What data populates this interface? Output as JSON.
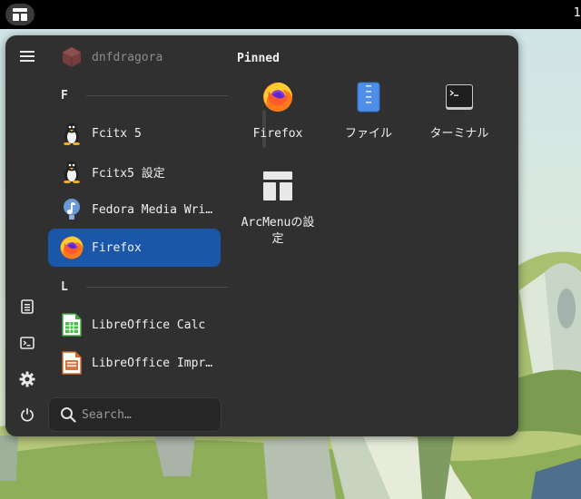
{
  "topbar": {
    "apps_icon": "activities-grid-icon",
    "clock_partial": "1"
  },
  "sidebar": {
    "icons": [
      "hamburger-menu-icon",
      "document-icon",
      "terminal-icon",
      "gear-icon",
      "power-icon"
    ]
  },
  "app_list": {
    "top_item": "dnfdragora",
    "sections": [
      {
        "letter": "F",
        "apps": [
          {
            "label": "Fcitx 5",
            "icon": "penguin-icon"
          },
          {
            "label": "Fcitx5 設定",
            "icon": "penguin-icon"
          },
          {
            "label": "Fedora Media Wri…",
            "icon": "fedora-icon"
          },
          {
            "label": "Firefox",
            "icon": "firefox-icon",
            "selected": true
          }
        ]
      },
      {
        "letter": "L",
        "apps": [
          {
            "label": "LibreOffice Calc",
            "icon": "calc-icon"
          },
          {
            "label": "LibreOffice Impr…",
            "icon": "impress-icon"
          }
        ]
      }
    ]
  },
  "search": {
    "placeholder": "Search…",
    "value": ""
  },
  "pinned": {
    "title": "Pinned",
    "items": [
      {
        "label": "Firefox",
        "icon": "firefox-icon"
      },
      {
        "label": "ファイル",
        "icon": "files-icon"
      },
      {
        "label": "ターミナル",
        "icon": "terminal-icon"
      },
      {
        "label_line1": "ArcMenuの設",
        "label_line2": "定",
        "icon": "arcmenu-icon"
      }
    ]
  },
  "colors": {
    "menu_bg": "#303030",
    "selected": "#1b57a8",
    "topbar": "#000000"
  }
}
